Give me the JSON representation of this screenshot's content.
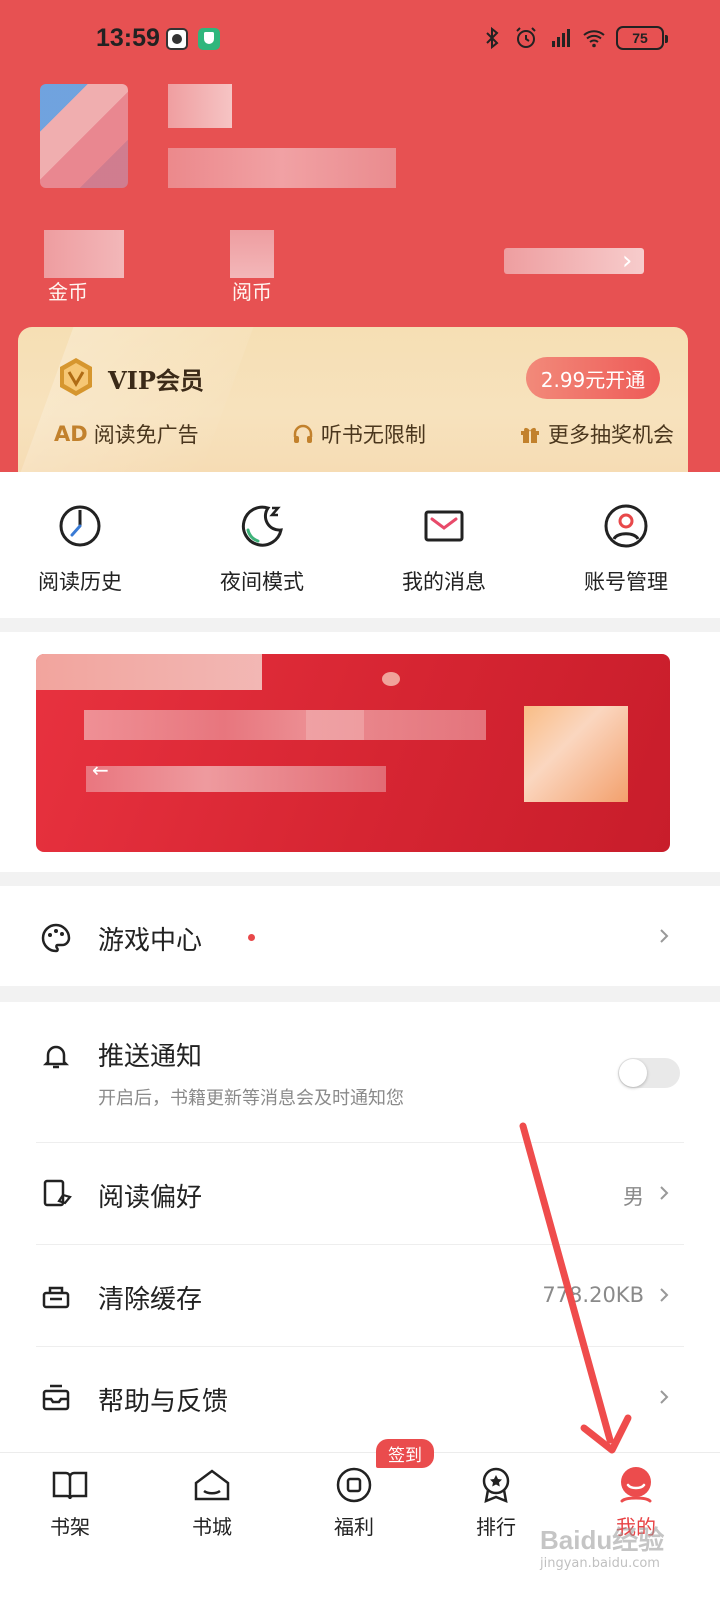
{
  "status_bar": {
    "time": "13:59",
    "battery": "75",
    "icons": [
      "bluetooth-icon",
      "alarm-icon",
      "hd-signal-icon",
      "wifi-icon"
    ]
  },
  "profile": {
    "coin_label": "金币",
    "currency_label": "阅币"
  },
  "vip": {
    "title": "VIP会员",
    "button": "2.99元开通",
    "perks": [
      {
        "icon": "ad-icon",
        "icon_text": "AD",
        "label": "阅读免广告"
      },
      {
        "icon": "headphones-icon",
        "label": "听书无限制"
      },
      {
        "icon": "gift-icon",
        "label": "更多抽奖机会"
      }
    ]
  },
  "quick_actions": [
    {
      "icon": "clock-icon",
      "label": "阅读历史"
    },
    {
      "icon": "moon-icon",
      "label": "夜间模式"
    },
    {
      "icon": "envelope-icon",
      "label": "我的消息"
    },
    {
      "icon": "user-circle-icon",
      "label": "账号管理"
    }
  ],
  "game_center": {
    "title": "游戏中心",
    "icon": "palette-icon",
    "has_red_dot": true
  },
  "settings": {
    "push": {
      "title": "推送通知",
      "subtitle": "开启后，书籍更新等消息会及时通知您",
      "enabled": false
    },
    "reading_pref": {
      "title": "阅读偏好",
      "value": "男"
    },
    "clear_cache": {
      "title": "清除缓存",
      "value": "778.20KB"
    },
    "help": {
      "title": "帮助与反馈"
    }
  },
  "bottom_nav": {
    "items": [
      {
        "icon": "book-icon",
        "label": "书架"
      },
      {
        "icon": "store-icon",
        "label": "书城"
      },
      {
        "icon": "coin-box-icon",
        "label": "福利",
        "badge": "签到"
      },
      {
        "icon": "medal-icon",
        "label": "排行"
      },
      {
        "icon": "profile-icon",
        "label": "我的",
        "active": true
      }
    ]
  },
  "colors": {
    "header_red": "#e75152",
    "accent_red": "#e84345",
    "vip_gold": "#f6dfb4"
  },
  "watermark": {
    "text": "Baidu经验",
    "sub": "jingyan.baidu.com"
  }
}
